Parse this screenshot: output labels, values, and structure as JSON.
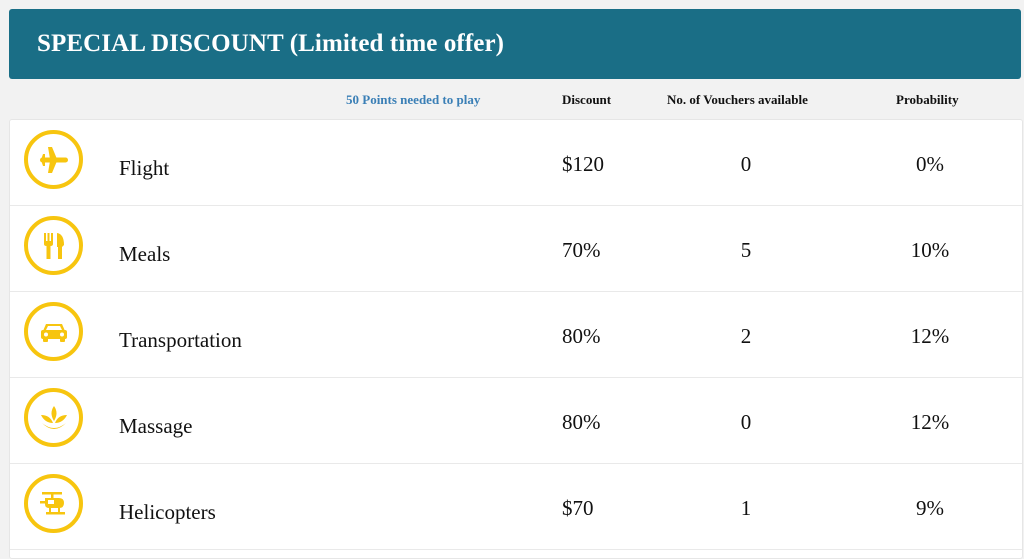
{
  "header": {
    "title": "SPECIAL DISCOUNT (Limited time offer)"
  },
  "columns": {
    "points_note": "50 Points needed to play",
    "discount": "Discount",
    "vouchers": "No. of Vouchers available",
    "probability": "Probability"
  },
  "accent_color": "#f7c50f",
  "header_color": "#1a6e86",
  "rows": [
    {
      "icon": "plane-icon",
      "name": "Flight",
      "discount": "$120",
      "vouchers": "0",
      "probability": "0%"
    },
    {
      "icon": "fork-knife-icon",
      "name": "Meals",
      "discount": "70%",
      "vouchers": "5",
      "probability": "10%"
    },
    {
      "icon": "car-icon",
      "name": "Transportation",
      "discount": "80%",
      "vouchers": "2",
      "probability": "12%"
    },
    {
      "icon": "lotus-icon",
      "name": "Massage",
      "discount": "80%",
      "vouchers": "0",
      "probability": "12%"
    },
    {
      "icon": "helicopter-icon",
      "name": "Helicopters",
      "discount": "$70",
      "vouchers": "1",
      "probability": "9%"
    }
  ]
}
